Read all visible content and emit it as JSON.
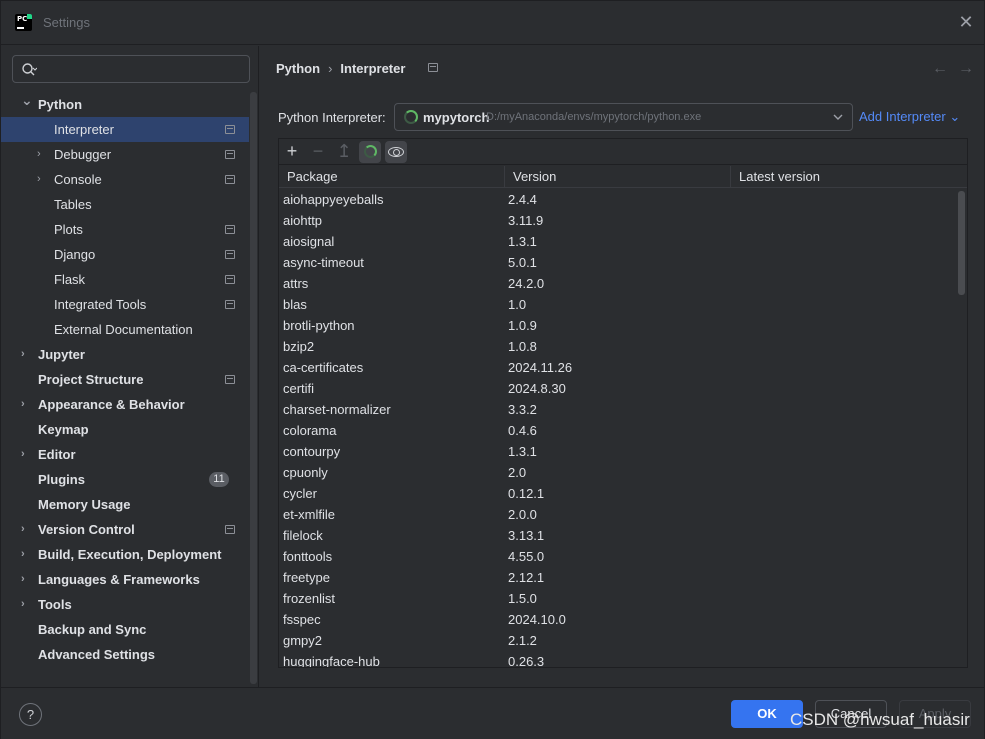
{
  "window": {
    "title": "Settings"
  },
  "search": {
    "placeholder": "",
    "value": ""
  },
  "sidebar": {
    "items": [
      {
        "label": "Python",
        "level": 0,
        "bold": true,
        "arrow": "down",
        "proj": false
      },
      {
        "label": "Interpreter",
        "level": 1,
        "bold": false,
        "arrow": "",
        "proj": true,
        "selected": true
      },
      {
        "label": "Debugger",
        "level": 1,
        "bold": false,
        "arrow": "right",
        "proj": true
      },
      {
        "label": "Console",
        "level": 1,
        "bold": false,
        "arrow": "right",
        "proj": true
      },
      {
        "label": "Tables",
        "level": 1,
        "bold": false,
        "arrow": "",
        "proj": false
      },
      {
        "label": "Plots",
        "level": 1,
        "bold": false,
        "arrow": "",
        "proj": true
      },
      {
        "label": "Django",
        "level": 1,
        "bold": false,
        "arrow": "",
        "proj": true
      },
      {
        "label": "Flask",
        "level": 1,
        "bold": false,
        "arrow": "",
        "proj": true
      },
      {
        "label": "Integrated Tools",
        "level": 1,
        "bold": false,
        "arrow": "",
        "proj": true
      },
      {
        "label": "External Documentation",
        "level": 1,
        "bold": false,
        "arrow": "",
        "proj": false
      },
      {
        "label": "Jupyter",
        "level": 0,
        "bold": true,
        "arrow": "right",
        "proj": false
      },
      {
        "label": "Project Structure",
        "level": 0,
        "bold": true,
        "arrow": "",
        "proj": true
      },
      {
        "label": "Appearance & Behavior",
        "level": 0,
        "bold": true,
        "arrow": "right",
        "proj": false
      },
      {
        "label": "Keymap",
        "level": 0,
        "bold": true,
        "arrow": "",
        "proj": false
      },
      {
        "label": "Editor",
        "level": 0,
        "bold": true,
        "arrow": "right",
        "proj": false
      },
      {
        "label": "Plugins",
        "level": 0,
        "bold": true,
        "arrow": "",
        "proj": false,
        "badge": "11"
      },
      {
        "label": "Memory Usage",
        "level": 0,
        "bold": true,
        "arrow": "",
        "proj": false
      },
      {
        "label": "Version Control",
        "level": 0,
        "bold": true,
        "arrow": "right",
        "proj": true
      },
      {
        "label": "Build, Execution, Deployment",
        "level": 0,
        "bold": true,
        "arrow": "right",
        "proj": false
      },
      {
        "label": "Languages & Frameworks",
        "level": 0,
        "bold": true,
        "arrow": "right",
        "proj": false
      },
      {
        "label": "Tools",
        "level": 0,
        "bold": true,
        "arrow": "right",
        "proj": false
      },
      {
        "label": "Backup and Sync",
        "level": 0,
        "bold": true,
        "arrow": "",
        "proj": false
      },
      {
        "label": "Advanced Settings",
        "level": 0,
        "bold": true,
        "arrow": "",
        "proj": false
      }
    ]
  },
  "breadcrumb": {
    "parent": "Python",
    "separator": "›",
    "current": "Interpreter"
  },
  "nav": {
    "back": "←",
    "forward": "→"
  },
  "interpreter": {
    "label": "Python Interpreter:",
    "name": "mypytorch",
    "path": "D:/myAnaconda/envs/mypytorch/python.exe",
    "add_label": "Add Interpreter",
    "add_chevron": "⌄"
  },
  "toolbar": {
    "add": "+",
    "remove": "−",
    "upgrade": "↥"
  },
  "table": {
    "headers": {
      "package": "Package",
      "version": "Version",
      "latest": "Latest version"
    },
    "rows": [
      {
        "package": "aiohappyeyeballs",
        "version": "2.4.4",
        "latest": ""
      },
      {
        "package": "aiohttp",
        "version": "3.11.9",
        "latest": ""
      },
      {
        "package": "aiosignal",
        "version": "1.3.1",
        "latest": ""
      },
      {
        "package": "async-timeout",
        "version": "5.0.1",
        "latest": ""
      },
      {
        "package": "attrs",
        "version": "24.2.0",
        "latest": ""
      },
      {
        "package": "blas",
        "version": "1.0",
        "latest": ""
      },
      {
        "package": "brotli-python",
        "version": "1.0.9",
        "latest": ""
      },
      {
        "package": "bzip2",
        "version": "1.0.8",
        "latest": ""
      },
      {
        "package": "ca-certificates",
        "version": "2024.11.26",
        "latest": ""
      },
      {
        "package": "certifi",
        "version": "2024.8.30",
        "latest": ""
      },
      {
        "package": "charset-normalizer",
        "version": "3.3.2",
        "latest": ""
      },
      {
        "package": "colorama",
        "version": "0.4.6",
        "latest": ""
      },
      {
        "package": "contourpy",
        "version": "1.3.1",
        "latest": ""
      },
      {
        "package": "cpuonly",
        "version": "2.0",
        "latest": ""
      },
      {
        "package": "cycler",
        "version": "0.12.1",
        "latest": ""
      },
      {
        "package": "et-xmlfile",
        "version": "2.0.0",
        "latest": ""
      },
      {
        "package": "filelock",
        "version": "3.13.1",
        "latest": ""
      },
      {
        "package": "fonttools",
        "version": "4.55.0",
        "latest": ""
      },
      {
        "package": "freetype",
        "version": "2.12.1",
        "latest": ""
      },
      {
        "package": "frozenlist",
        "version": "1.5.0",
        "latest": ""
      },
      {
        "package": "fsspec",
        "version": "2024.10.0",
        "latest": ""
      },
      {
        "package": "gmpy2",
        "version": "2.1.2",
        "latest": ""
      },
      {
        "package": "huggingface-hub",
        "version": "0.26.3",
        "latest": ""
      }
    ]
  },
  "footer": {
    "help": "?",
    "ok": "OK",
    "cancel": "Cancel",
    "apply": "Apply",
    "watermark": "CSDN @hwsuaf_huasir"
  },
  "colors": {
    "background": "#2b2d30",
    "selection": "#2e436e",
    "accent": "#3574f0",
    "link": "#548af7",
    "spinner": "#5fb865"
  }
}
